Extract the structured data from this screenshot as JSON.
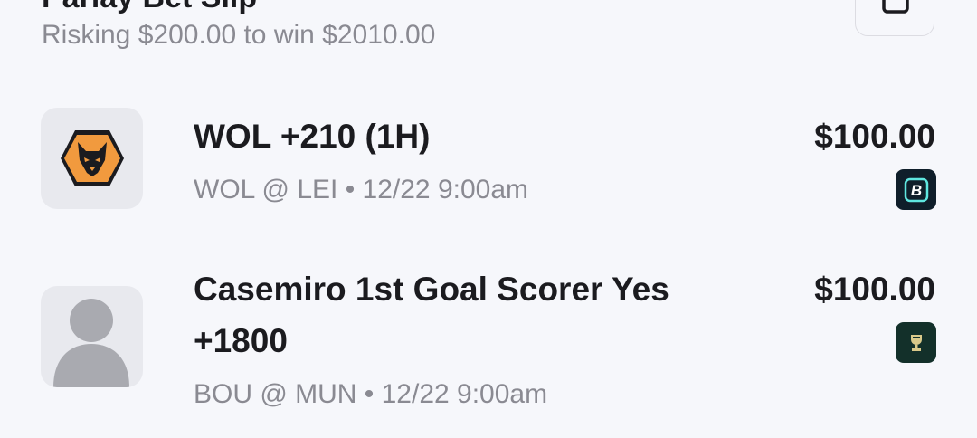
{
  "header": {
    "title": "Parlay Bet Slip",
    "subtitle": "Risking $200.00 to win $2010.00"
  },
  "share": {
    "icon": "share-icon"
  },
  "bets": [
    {
      "title": "WOL +210 (1H)",
      "meta": "WOL @ LEI • 12/22 9:00am",
      "amount": "$100.00",
      "thumb_icon": "wolves-crest-icon",
      "book_icon": "sportsbook-b-logo-icon"
    },
    {
      "title": "Casemiro 1st Goal Scorer Yes +1800",
      "meta": "BOU @ MUN • 12/22 9:00am",
      "amount": "$100.00",
      "thumb_icon": "player-placeholder-icon",
      "book_icon": "sportsbook-trophy-logo-icon"
    }
  ],
  "colors": {
    "background": "#f6f7fb",
    "text_primary": "#1b1b1f",
    "text_secondary": "#8a8a92",
    "wolves_orange": "#f19a3e",
    "badge_dark": "#0f1e2a",
    "badge_green": "#13302a"
  }
}
